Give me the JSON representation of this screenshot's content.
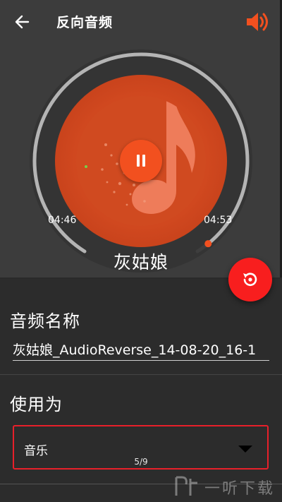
{
  "header": {
    "title": "反向音频",
    "back_icon": "arrow-left-icon",
    "volume_icon": "speaker-volume-icon"
  },
  "player": {
    "elapsed": "04:46",
    "duration": "04:53",
    "progress_fraction": 0.976,
    "song_title": "灰姑娘",
    "state": "playing",
    "accent_color": "#f2501f"
  },
  "form": {
    "name_label": "音频名称",
    "name_value": "灰姑娘_AudioReverse_14-08-20_16-1",
    "use_label": "使用为",
    "use_value": "音乐"
  },
  "fab": {
    "icon": "reverse-play-icon",
    "color": "#f81e1e"
  },
  "pager": {
    "text": "5/9"
  },
  "watermark": {
    "text": "一听下载"
  }
}
